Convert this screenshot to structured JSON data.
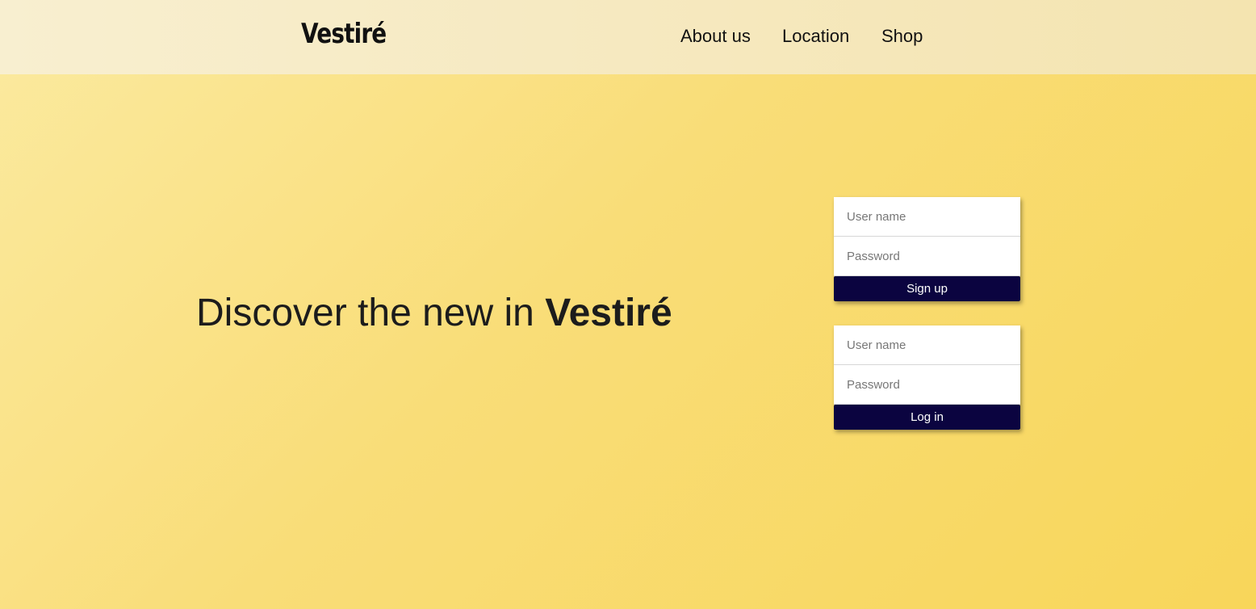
{
  "header": {
    "brand": "Vestiré",
    "nav": [
      "About us",
      "Location",
      "Shop"
    ]
  },
  "hero": {
    "text": "Discover the new in",
    "brand": "Vestiré"
  },
  "signup_form": {
    "username_placeholder": "User name",
    "password_placeholder": "Password",
    "button_label": "Sign up"
  },
  "login_form": {
    "username_placeholder": "User name",
    "password_placeholder": "Password",
    "button_label": "Log in"
  },
  "colors": {
    "button_bg": "#0b0440",
    "header_bg": "#f6e9c0",
    "page_bg": "#f9dd78"
  }
}
